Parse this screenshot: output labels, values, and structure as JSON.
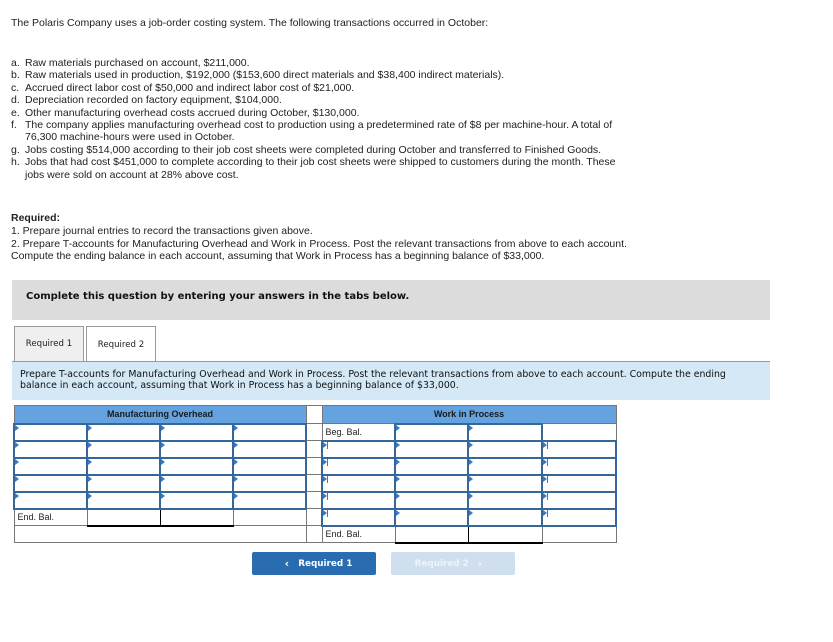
{
  "intro": "The Polaris Company uses a job-order costing system. The following transactions occurred in October:",
  "transactions": [
    {
      "label": "a.",
      "lines": [
        "Raw materials purchased on account, $211,000."
      ]
    },
    {
      "label": "b.",
      "lines": [
        "Raw materials used in production, $192,000 ($153,600 direct materials and $38,400 indirect materials)."
      ]
    },
    {
      "label": "c.",
      "lines": [
        "Accrued direct labor cost of $50,000 and indirect labor cost of $21,000."
      ]
    },
    {
      "label": "d.",
      "lines": [
        "Depreciation recorded on factory equipment, $104,000."
      ]
    },
    {
      "label": "e.",
      "lines": [
        "Other manufacturing overhead costs accrued during October, $130,000."
      ]
    },
    {
      "label": "f.",
      "lines": [
        "The company applies manufacturing overhead cost to production using a predetermined rate of $8 per machine-hour. A total of",
        "76,300 machine-hours were used in October."
      ]
    },
    {
      "label": "g.",
      "lines": [
        "Jobs costing $514,000 according to their job cost sheets were completed during October and transferred to Finished Goods."
      ]
    },
    {
      "label": "h.",
      "lines": [
        "Jobs that had cost $451,000 to complete according to their job cost sheets were shipped to customers during the month. These",
        "jobs were sold on account at 28% above cost."
      ]
    }
  ],
  "required": {
    "title": "Required:",
    "items": [
      "1. Prepare journal entries to record the transactions given above.",
      "2. Prepare T-accounts for Manufacturing Overhead and Work in Process. Post the relevant transactions from above to each account.",
      "Compute the ending balance in each account, assuming that Work in Process has a beginning balance of $33,000."
    ]
  },
  "banner": "Complete this question by entering your answers in the tabs below.",
  "tabs": [
    {
      "label": "Required 1",
      "active": false
    },
    {
      "label": "Required 2",
      "active": true
    }
  ],
  "instruction": "Prepare T-accounts for Manufacturing Overhead and Work in Process. Post the relevant transactions from above to each account. Compute the ending balance in each account, assuming that Work in Process has a beginning balance of $33,000.",
  "mfg_overhead": {
    "title": "Manufacturing Overhead",
    "input_rows": 5,
    "end_label": "End. Bal.",
    "values": []
  },
  "wip": {
    "title": "Work in Process",
    "beg_label": "Beg. Bal.",
    "input_rows": 5,
    "end_label": "End. Bal.",
    "values": []
  },
  "nav": {
    "prev_label": "Required 1",
    "next_label": "Required 2",
    "prev_icon": "chevron-left-icon",
    "next_icon": "chevron-right-icon"
  },
  "colors": {
    "header_blue": "#65a3e0",
    "instruction_bg": "#d4e8f6",
    "banner_bg": "#dcdcdc",
    "prev_button": "#2a6cb0",
    "next_button_disabled": "#cfdfee",
    "input_border": "#35689a"
  }
}
